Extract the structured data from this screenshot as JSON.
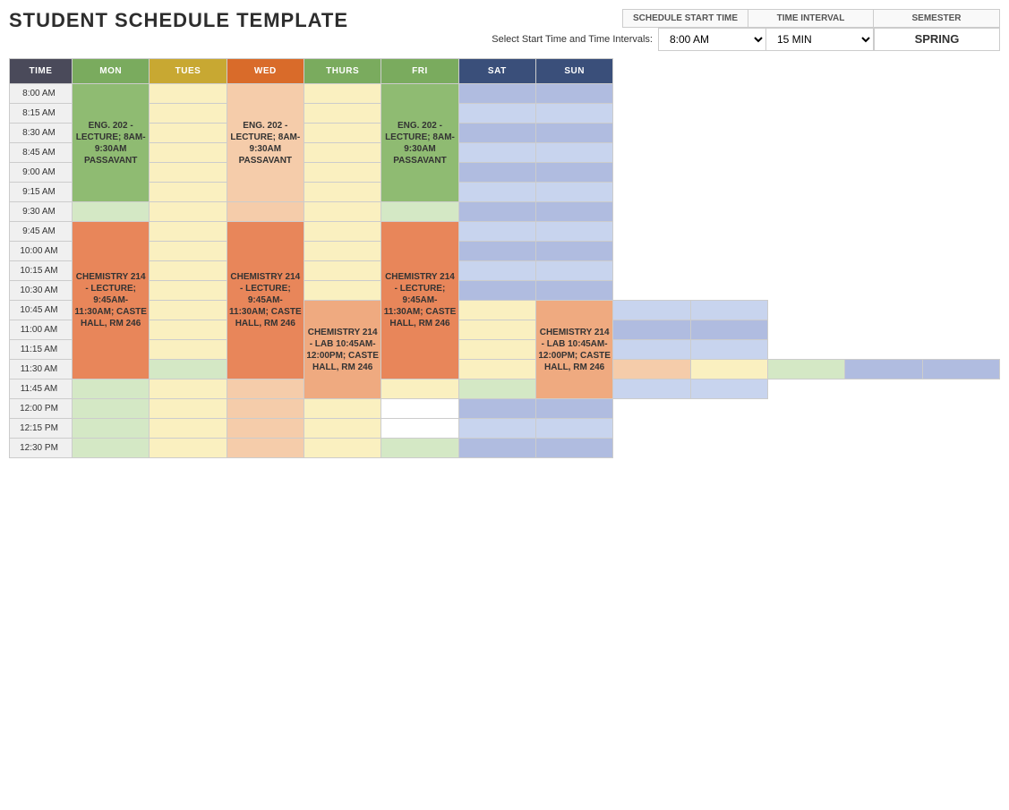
{
  "title": "STUDENT SCHEDULE TEMPLATE",
  "controls": {
    "start_time_header": "SCHEDULE START TIME",
    "time_interval_header": "TIME INTERVAL",
    "semester_header": "SEMESTER",
    "label": "Select Start Time and Time Intervals:",
    "start_time_value": "8:00 AM",
    "time_interval_value": "15 MIN",
    "semester_value": "SPRING"
  },
  "headers": {
    "time": "TIME",
    "mon": "MON",
    "tues": "TUES",
    "wed": "WED",
    "thurs": "THURS",
    "fri": "FRI",
    "sat": "SAT",
    "sun": "SUN"
  },
  "events": {
    "eng_202": "ENG. 202 - LECTURE; 8AM-9:30AM PASSAVANT",
    "chem_214_lec_mwf": "CHEMISTRY 214 - LECTURE; 9:45AM-11:30AM; CASTE HALL, RM 246",
    "chem_214_lab_t": "CHEMISTRY 214 - LAB 10:45AM-12:00PM; CASTE HALL, RM 246",
    "chem_214_lab_th": "CHEMISTRY 214 - LAB 10:45AM-12:00PM; CASTE HALL, RM 246"
  }
}
